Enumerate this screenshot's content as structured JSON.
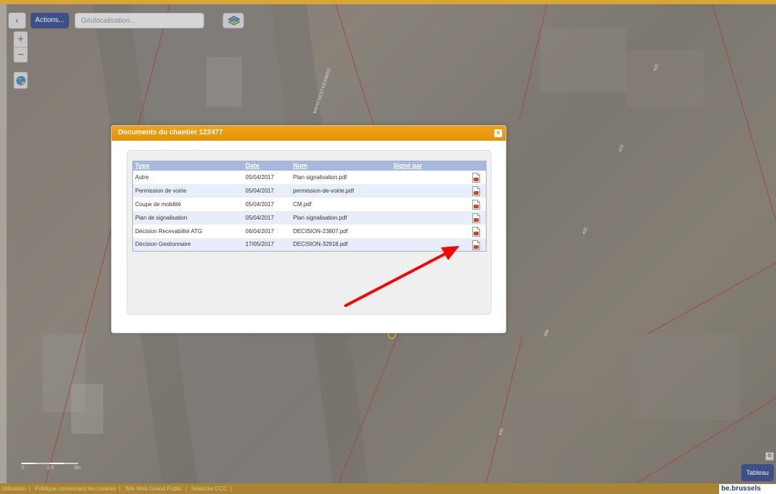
{
  "toolbar": {
    "collapse_label": "‹",
    "actions_label": "Actions...",
    "geo_placeholder": "Géolocalisation..."
  },
  "map": {
    "street_name": "WERFSESTEENWEG",
    "parcel_labels": [
      "421",
      "423",
      "432",
      "439",
      "435",
      "433"
    ],
    "scale_labels": [
      "0",
      "1.5",
      "3m"
    ],
    "tableau_label": "Tableau"
  },
  "modal": {
    "title": "Documents du chantier 122477",
    "close_label": "×",
    "columns": [
      "Type",
      "Date",
      "Nom",
      "Signé par"
    ],
    "rows": [
      {
        "type": "Autre",
        "date": "05/04/2017",
        "nom": "Plan signalisation.pdf",
        "signe": ""
      },
      {
        "type": "Permission de voirie",
        "date": "05/04/2017",
        "nom": "permission-de-voirie.pdf",
        "signe": ""
      },
      {
        "type": "Coupe de mobilité",
        "date": "05/04/2017",
        "nom": "CM.pdf",
        "signe": ""
      },
      {
        "type": "Plan de signalisation",
        "date": "05/04/2017",
        "nom": "Plan signalisation.pdf",
        "signe": ""
      },
      {
        "type": "Décision Recevabilité ATG",
        "date": "06/04/2017",
        "nom": "DECISION-23807.pdf",
        "signe": ""
      },
      {
        "type": "Décision Gestionnaire",
        "date": "17/05/2017",
        "nom": "DECISION-32918.pdf",
        "signe": ""
      }
    ]
  },
  "footer": {
    "links": [
      "Utilisation",
      "Politique concernant les cookies",
      "Site Web Grand Public",
      "Séances CCC"
    ],
    "brand": "be.brussels"
  },
  "colors": {
    "modal_header": "#e49205",
    "table_header": "#a6b9dc",
    "actions_button": "#3c4f86",
    "annotation_arrow": "#ff0000"
  }
}
